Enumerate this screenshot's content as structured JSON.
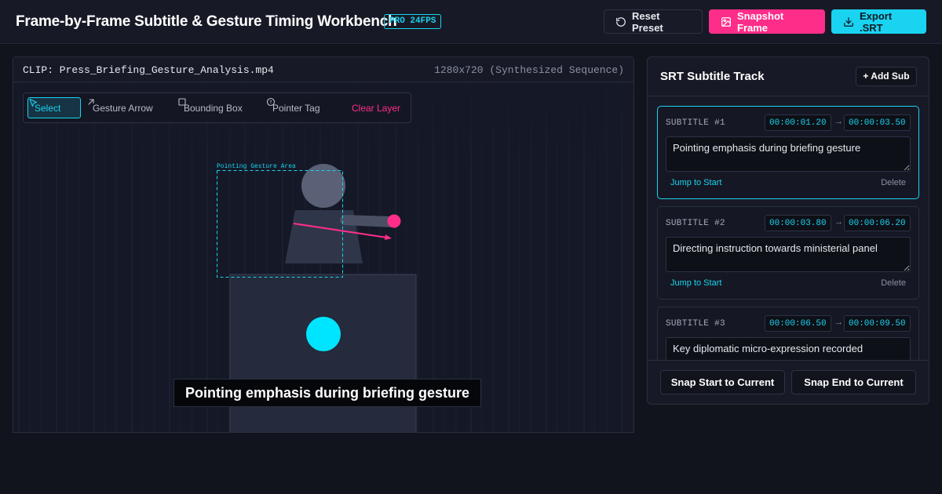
{
  "header": {
    "title": "Frame-by-Frame Subtitle & Gesture Timing Workbench",
    "badge": "PRO 24FPS",
    "reset_label": "Reset Preset",
    "snapshot_label": "Snapshot Frame",
    "export_label": "Export .SRT"
  },
  "video": {
    "clip_name": "CLIP: Press_Briefing_Gesture_Analysis.mp4",
    "resolution": "1280x720 (Synthesized Sequence)",
    "annotation_label": "Pointing Gesture Area",
    "current_subtitle": "Pointing emphasis during briefing gesture"
  },
  "toolbar": {
    "tools": [
      {
        "label": "Select",
        "icon": "cursor-icon",
        "active": true
      },
      {
        "label": "Gesture Arrow",
        "icon": "arrow-up-right-icon",
        "active": false
      },
      {
        "label": "Bounding Box",
        "icon": "square-icon",
        "active": false
      },
      {
        "label": "Pointer Tag",
        "icon": "info-circle-icon",
        "active": false
      }
    ],
    "clear_label": "Clear Layer"
  },
  "srt": {
    "title": "SRT Subtitle Track",
    "add_label": "+ Add Sub",
    "jump_label": "Jump to Start",
    "delete_label": "Delete",
    "subtitles": [
      {
        "label": "SUBTITLE #1",
        "start": "00:00:01.200",
        "end": "00:00:03.500",
        "text": "Pointing emphasis during briefing gesture",
        "active": true
      },
      {
        "label": "SUBTITLE #2",
        "start": "00:00:03.800",
        "end": "00:00:06.200",
        "text": "Directing instruction towards ministerial panel",
        "active": false
      },
      {
        "label": "SUBTITLE #3",
        "start": "00:00:06.500",
        "end": "00:00:09.500",
        "text": "Key diplomatic micro-expression recorded",
        "active": false
      }
    ],
    "snap_start_label": "Snap Start to Current",
    "snap_end_label": "Snap End to Current"
  },
  "colors": {
    "accent": "#19d3f0",
    "highlight": "#ff2d8a",
    "background": "#12141d"
  }
}
